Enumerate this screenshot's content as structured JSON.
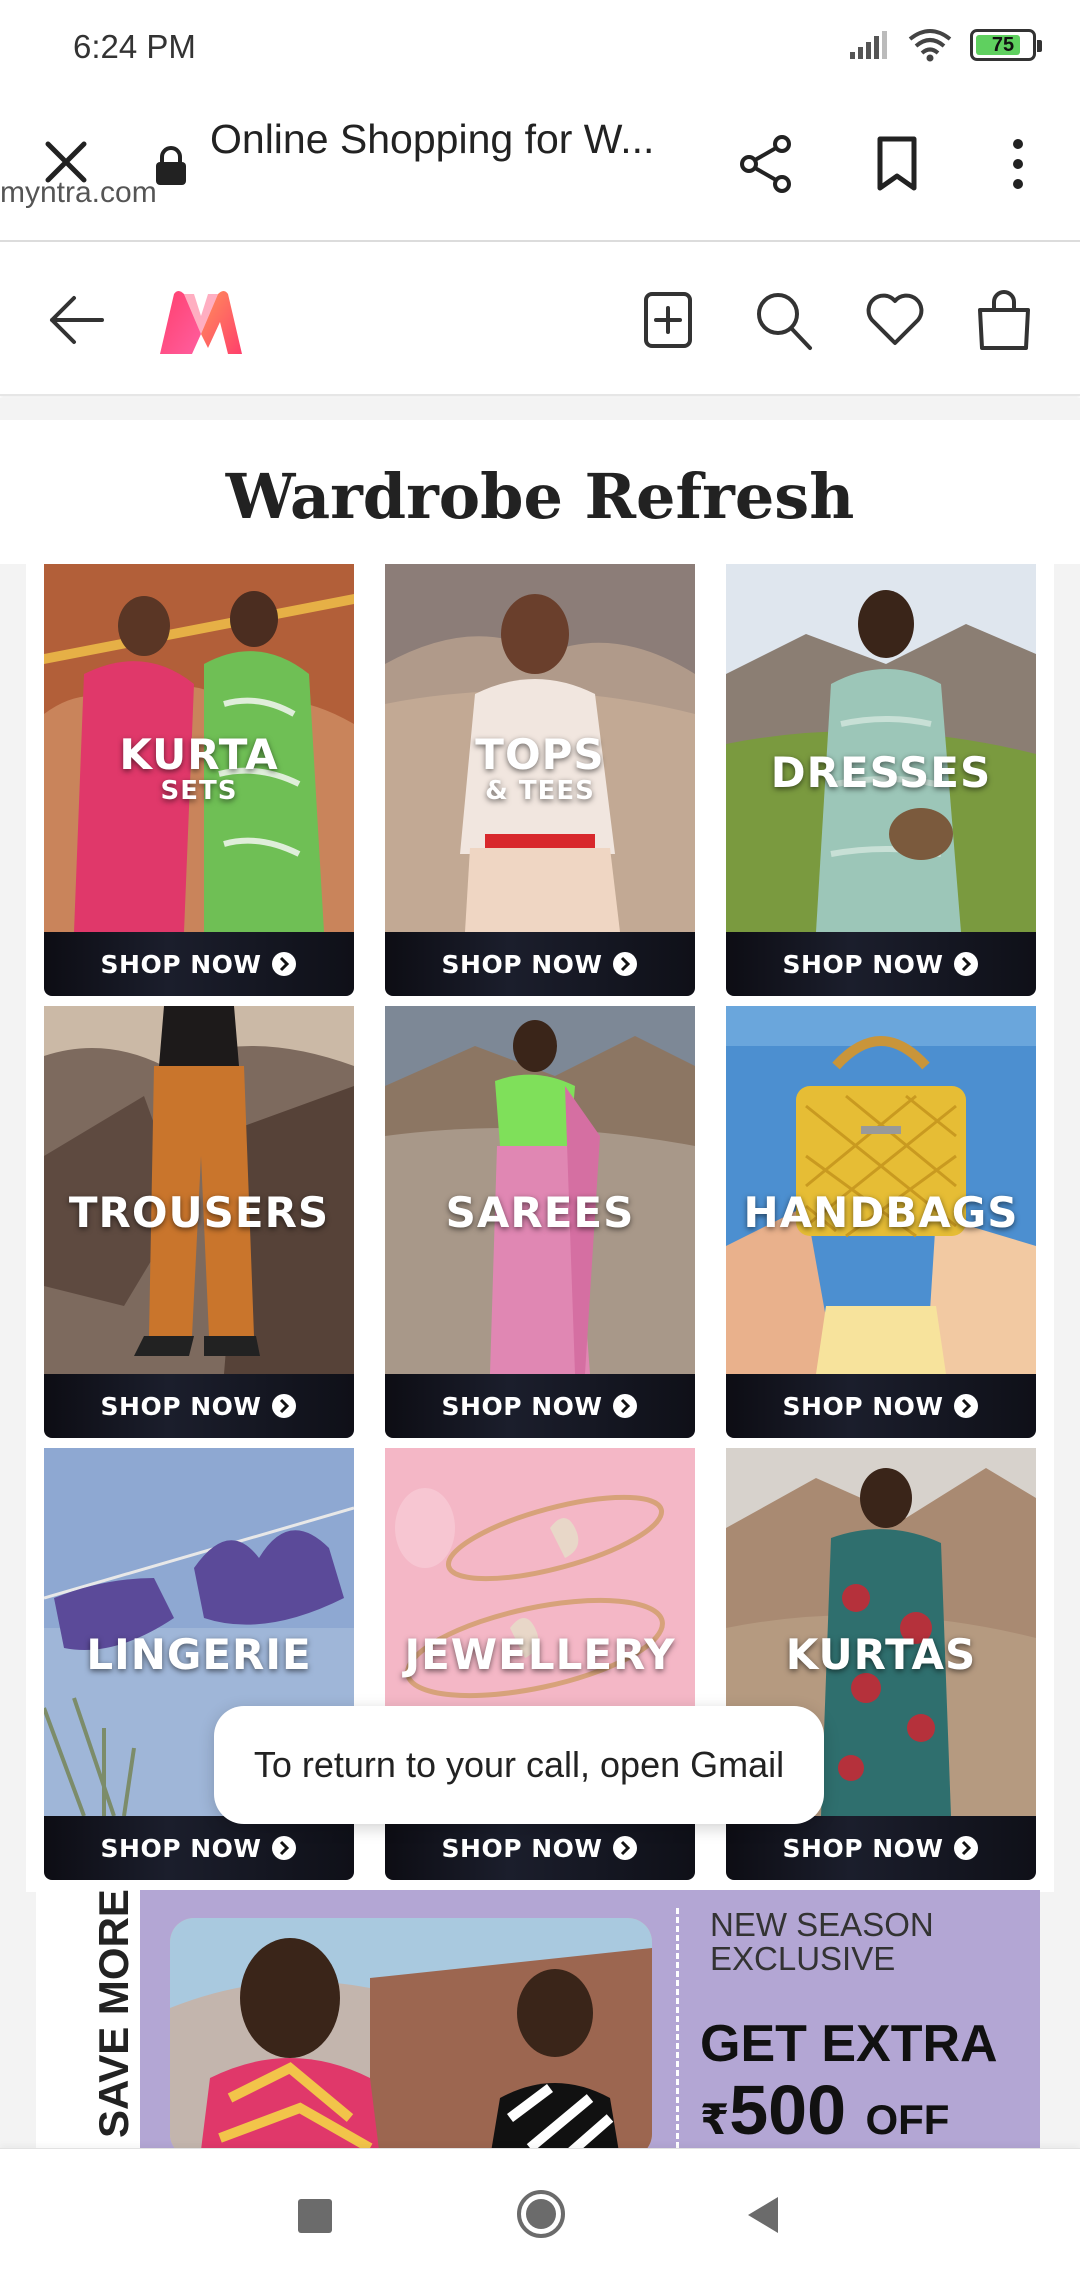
{
  "status_bar": {
    "time": "6:24 PM",
    "battery": "75"
  },
  "browser": {
    "page_title": "Online Shopping for W...",
    "url": "myntra.com"
  },
  "section": {
    "title": "Wardrobe Refresh"
  },
  "tiles": [
    {
      "label": "KURTA",
      "sub": "SETS",
      "cta": "SHOP NOW"
    },
    {
      "label": "TOPS",
      "sub": "& TEES",
      "cta": "SHOP NOW"
    },
    {
      "label": "DRESSES",
      "sub": "",
      "cta": "SHOP NOW"
    },
    {
      "label": "TROUSERS",
      "sub": "",
      "cta": "SHOP NOW"
    },
    {
      "label": "SAREES",
      "sub": "",
      "cta": "SHOP NOW"
    },
    {
      "label": "HANDBAGS",
      "sub": "",
      "cta": "SHOP NOW"
    },
    {
      "label": "LINGERIE",
      "sub": "",
      "cta": "SHOP NOW"
    },
    {
      "label": "JEWELLERY",
      "sub": "",
      "cta": "SHOP NOW"
    },
    {
      "label": "KURTAS",
      "sub": "",
      "cta": "SHOP NOW"
    }
  ],
  "toast": {
    "message": "To return to your call, open Gmail"
  },
  "banner": {
    "side_text": "SAVE MORE",
    "tag_line1": "NEW SEASON",
    "tag_line2": "EXCLUSIVE",
    "headline": "GET EXTRA",
    "currency": "₹",
    "amount": "500",
    "suffix": "OFF"
  },
  "colors": {
    "brand_pink": "#ff3f6c",
    "brand_orange": "#ff905a",
    "banner_bg": "#b3a6d4"
  }
}
